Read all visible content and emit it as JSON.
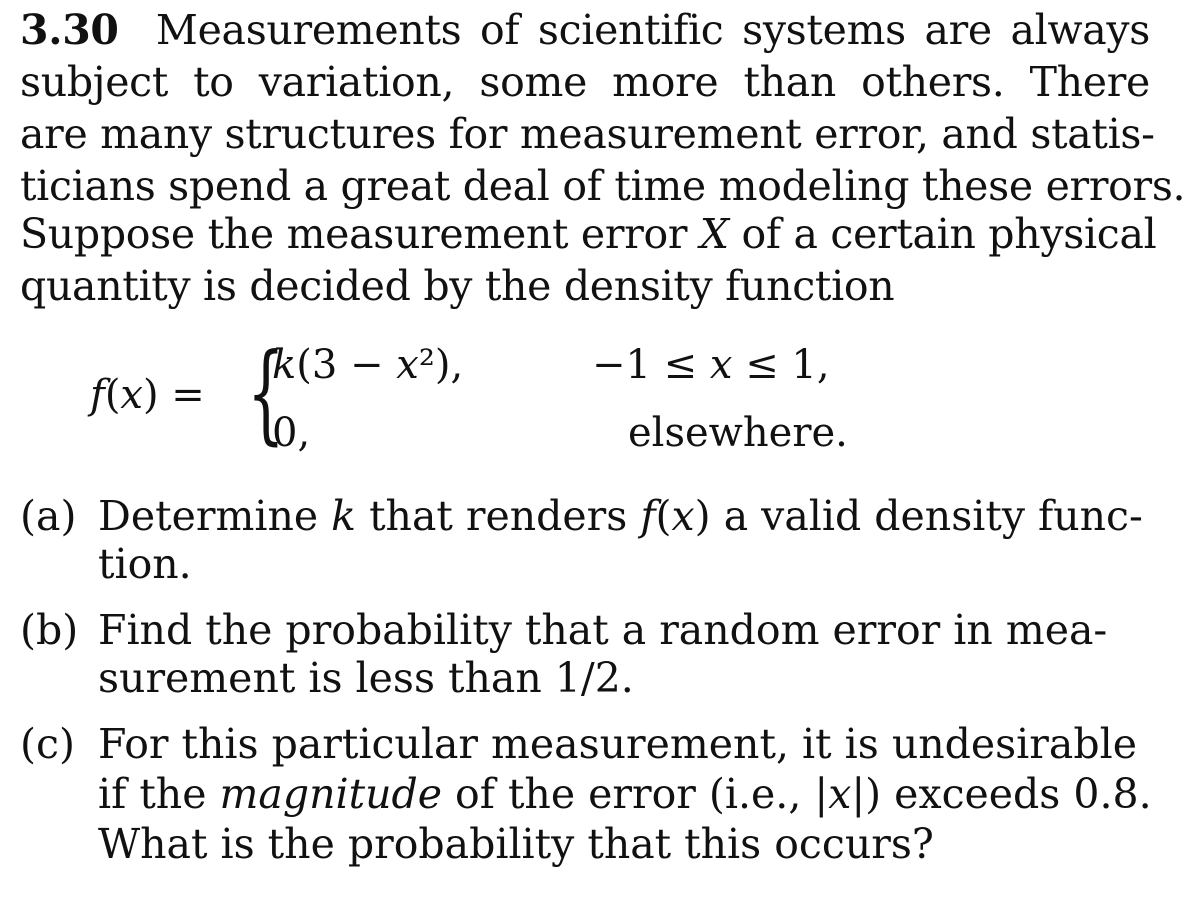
{
  "problem": {
    "number": "3.30",
    "intro_lines": [
      "Measurements of scientific systems are always",
      "subject to variation, some more than others. There",
      "are many structures for measurement error, and statis-",
      "ticians spend a great deal of time modeling these errors.",
      "Suppose the measurement error",
      "of a certain physical",
      "quantity is decided by the density function"
    ],
    "variable": "X"
  },
  "equation": {
    "lhs": "f(x) =",
    "case1_expr": "k(3 − x²),",
    "case1_cond": "−1 ≤ x ≤ 1,",
    "case2_expr": "0,",
    "case2_cond": "elsewhere."
  },
  "parts": [
    {
      "label": "(a)",
      "lines": [
        "Determine k that renders f(x) a valid density func-",
        "tion."
      ]
    },
    {
      "label": "(b)",
      "lines": [
        "Find the probability that a random error in mea-",
        "surement is less than 1/2."
      ]
    },
    {
      "label": "(c)",
      "lines": [
        "For this particular measurement, it is undesirable",
        "if the",
        "magnitude",
        "of the error (i.e., |x|) exceeds 0.8.",
        "What is the probability that this occurs?"
      ]
    }
  ]
}
